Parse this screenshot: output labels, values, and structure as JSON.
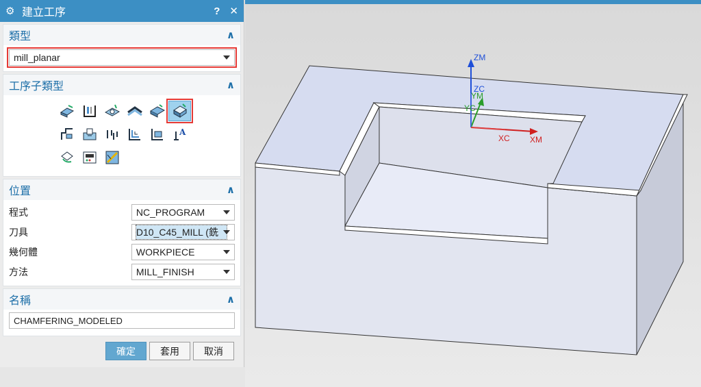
{
  "dialog": {
    "title": "建立工序",
    "help": "?",
    "close": "✕",
    "type_section": {
      "title": "類型",
      "selected": "mill_planar"
    },
    "subtype_section": {
      "title": "工序子類型"
    },
    "location_section": {
      "title": "位置",
      "rows": [
        {
          "label": "程式",
          "value": "NC_PROGRAM"
        },
        {
          "label": "刀具",
          "value": "D10_C45_MILL (銑"
        },
        {
          "label": "幾何體",
          "value": "WORKPIECE"
        },
        {
          "label": "方法",
          "value": "MILL_FINISH"
        }
      ]
    },
    "name_section": {
      "title": "名稱",
      "value": "CHAMFERING_MODELED"
    },
    "buttons": {
      "ok": "確定",
      "apply": "套用",
      "cancel": "取消"
    }
  },
  "viewport": {
    "axes": {
      "zm": "ZM",
      "zc": "ZC",
      "ym": "YM",
      "yc": "YC",
      "xc": "XC",
      "xm": "XM"
    }
  },
  "colors": {
    "titlebar": "#3c8fc4",
    "accent": "#1d6fa8",
    "highlight": "#e53935",
    "part": "#dde2ef"
  }
}
